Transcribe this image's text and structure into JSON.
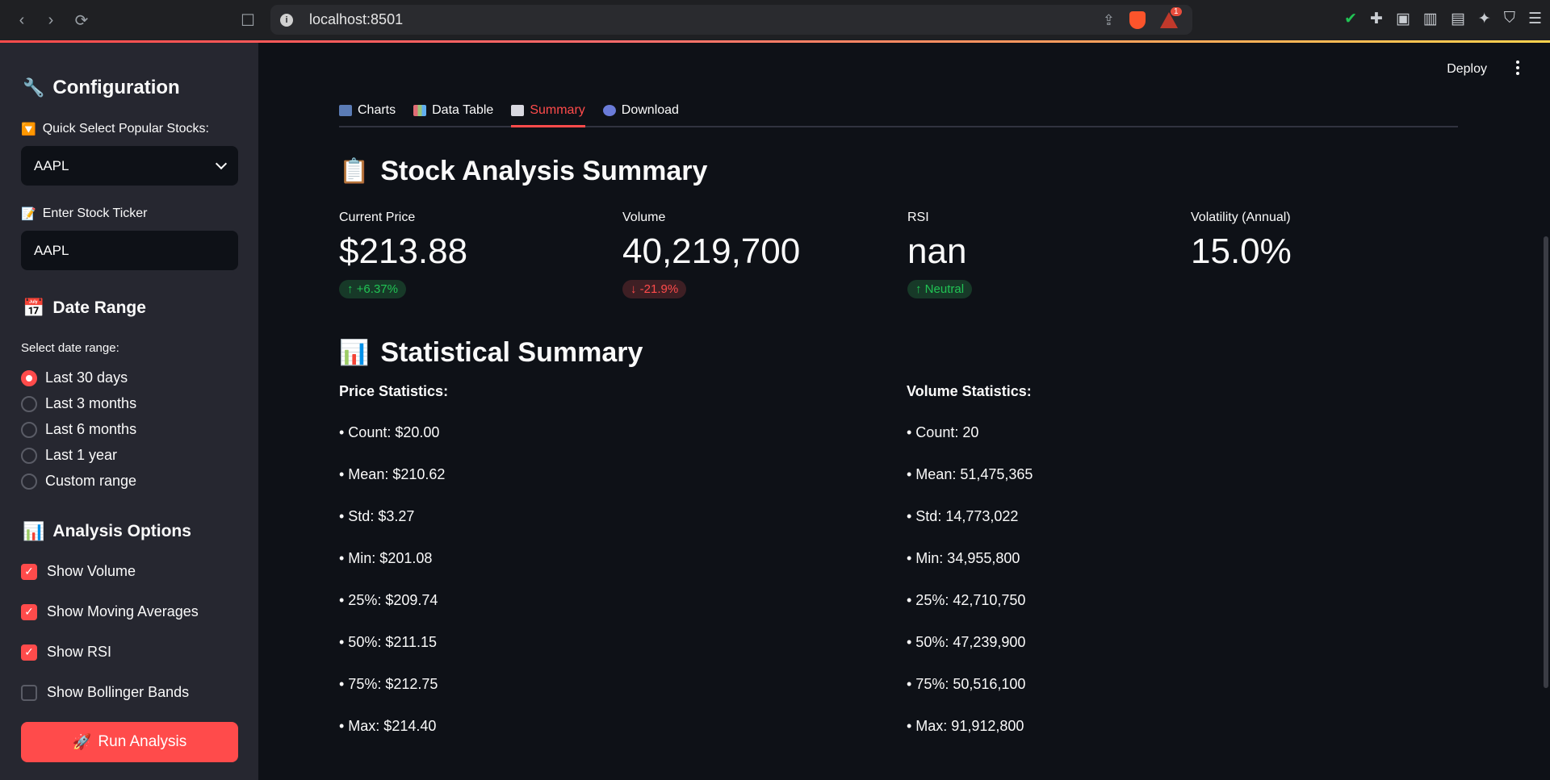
{
  "browser": {
    "url": "localhost:8501",
    "rewards_badge": "1"
  },
  "sidebar": {
    "config_heading": "Configuration",
    "quick_select_label": "Quick Select Popular Stocks:",
    "quick_select_value": "AAPL",
    "ticker_label": "Enter Stock Ticker",
    "ticker_value": "AAPL",
    "date_range_heading": "Date Range",
    "date_range_label": "Select date range:",
    "date_options": [
      {
        "label": "Last 30 days",
        "selected": true
      },
      {
        "label": "Last 3 months",
        "selected": false
      },
      {
        "label": "Last 6 months",
        "selected": false
      },
      {
        "label": "Last 1 year",
        "selected": false
      },
      {
        "label": "Custom range",
        "selected": false
      }
    ],
    "analysis_heading": "Analysis Options",
    "options": [
      {
        "label": "Show Volume",
        "checked": true
      },
      {
        "label": "Show Moving Averages",
        "checked": true
      },
      {
        "label": "Show RSI",
        "checked": true
      },
      {
        "label": "Show Bollinger Bands",
        "checked": false
      }
    ],
    "run_button": "Run Analysis"
  },
  "header": {
    "deploy": "Deploy"
  },
  "tabs": [
    {
      "label": "Charts",
      "active": false
    },
    {
      "label": "Data Table",
      "active": false
    },
    {
      "label": "Summary",
      "active": true
    },
    {
      "label": "Download",
      "active": false
    }
  ],
  "summary": {
    "title": "Stock Analysis Summary",
    "metrics": [
      {
        "label": "Current Price",
        "value": "$213.88",
        "delta": "+6.37%",
        "direction": "up"
      },
      {
        "label": "Volume",
        "value": "40,219,700",
        "delta": "-21.9%",
        "direction": "down"
      },
      {
        "label": "RSI",
        "value": "nan",
        "delta": "Neutral",
        "direction": "up"
      },
      {
        "label": "Volatility (Annual)",
        "value": "15.0%",
        "delta": "",
        "direction": ""
      }
    ]
  },
  "stats": {
    "title": "Statistical Summary",
    "price_title": "Price Statistics:",
    "price_items": [
      "• Count: $20.00",
      "• Mean: $210.62",
      "• Std: $3.27",
      "• Min: $201.08",
      "• 25%: $209.74",
      "• 50%: $211.15",
      "• 75%: $212.75",
      "• Max: $214.40"
    ],
    "volume_title": "Volume Statistics:",
    "volume_items": [
      "• Count: 20",
      "• Mean: 51,475,365",
      "• Std: 14,773,022",
      "• Min: 34,955,800",
      "• 25%: 42,710,750",
      "• 50%: 47,239,900",
      "• 75%: 50,516,100",
      "• Max: 91,912,800"
    ]
  },
  "colors": {
    "accent": "#ff4b4b",
    "positive": "#21c354",
    "sidebar_bg": "#262730",
    "main_bg": "#0e1117"
  }
}
